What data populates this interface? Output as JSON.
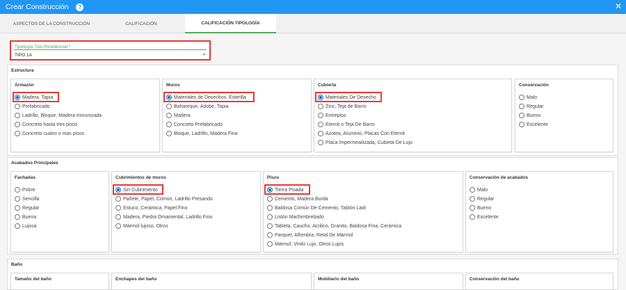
{
  "window": {
    "title": "Crear Construcción",
    "help_icon": "?",
    "close_icon": "✕"
  },
  "tabs": [
    {
      "label": "ASPECTOS DE LA CONSTRUCCIÓN",
      "active": false
    },
    {
      "label": "CALIFICACIÓN",
      "active": false
    },
    {
      "label": "CALIFICACIÓN TIPOLOGÍA",
      "active": true
    }
  ],
  "tipologia": {
    "label": "Tipología Tipo Residencial *",
    "value": "TIPO 1A"
  },
  "estructura": {
    "title": "Estructura",
    "armazon": {
      "title": "Armazón",
      "options": [
        "Madera, Tapia",
        "Prefabricado",
        "Ladrillo, Bloque, Madera Inmunizada",
        "Concreto hasta tres pisos",
        "Concreto cuatro o mas pisos"
      ],
      "selected": 0
    },
    "muros": {
      "title": "Muros",
      "options": [
        "Materiales de Desechos, Esterilla",
        "Bahareque, Adobe, Tapia",
        "Madera",
        "Concreto Prefabricado",
        "Bloque, Ladrillo, Madera Fina"
      ],
      "selected": 0
    },
    "cubierta": {
      "title": "Cubierta",
      "options": [
        "Materiales De Desecho",
        "Zinc, Teja de Barro",
        "Entrepiso",
        "Eternit o Teja De Barro",
        "Azotea, Aluminio, Placas Con Eternit",
        "Placa Impermeailizada, Cubieta De Lujo"
      ],
      "selected": 0
    },
    "conservacion": {
      "title": "Conservación",
      "options": [
        "Malo",
        "Regular",
        "Bueno",
        "Excelente"
      ],
      "selected": null
    }
  },
  "acabados": {
    "title": "Acabados Principales",
    "fachadas": {
      "title": "Fachadas",
      "options": [
        "Pobre",
        "Sencilla",
        "Regular",
        "Buena",
        "Lujosa"
      ],
      "selected": null
    },
    "cubrimientos": {
      "title": "Cubrimientos de muros",
      "options": [
        "Sin Cubrimiento",
        "Pañete, Papel, Común, Ladrillo Presando",
        "Estuco, Cerámica, Papel Fino",
        "Madera, Piedra Ornamental, Ladrillo Fino",
        "Mármol lujoso, Otros"
      ],
      "selected": 0
    },
    "pisos": {
      "title": "Pisos",
      "options": [
        "Tierra Pisada",
        "Cemento, Madera Burda",
        "Baldosa Común De Cemento, Tablón Ladr",
        "Listón Machimbrebado",
        "Tableta, Caucho, Acrilico, Granito, Baldosa Fina, Cerámica",
        "Parquet, Alfombra, Retal De Mármol",
        "Mármol, Vinilo Lujo, Otros Lujos"
      ],
      "selected": 0
    },
    "conservacion_acabados": {
      "title": "Conservación de acabados",
      "options": [
        "Malo",
        "Regular",
        "Bueno",
        "Excelente"
      ],
      "selected": null
    }
  },
  "bano": {
    "title": "Baño",
    "tamano": {
      "title": "Tamaño del baño"
    },
    "enchapes": {
      "title": "Enchapes del baño"
    },
    "mobiliario": {
      "title": "Mobiliario del baño"
    },
    "conservacion_bano": {
      "title": "Conservación del baño"
    }
  },
  "colors": {
    "primary": "#2196f3",
    "accent": "#4caf50",
    "highlight": "#e53935",
    "radio_checked": "#1565c0"
  }
}
